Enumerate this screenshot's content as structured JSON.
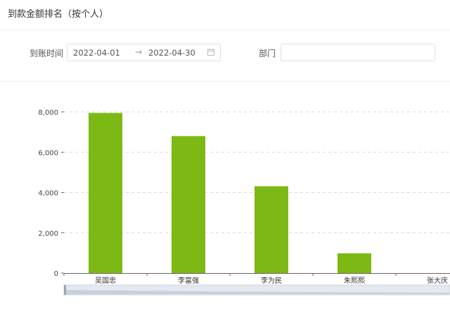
{
  "header": {
    "title": "到款金额排名（按个人）"
  },
  "filters": {
    "date_label": "到账时间",
    "start_date": "2022-04-01",
    "arrow": "→",
    "end_date": "2022-04-30",
    "dept_label": "部门",
    "dept_value": ""
  },
  "colors": {
    "bar": "#7db914",
    "grid": "#d9d9d9",
    "axis": "#666666"
  },
  "icons": {
    "calendar": "calendar-icon"
  },
  "chart_data": {
    "type": "bar",
    "categories": [
      "吴国忠",
      "李富强",
      "李为民",
      "朱熙熙",
      "张大庆"
    ],
    "values": [
      7950,
      6800,
      4310,
      980,
      0
    ],
    "y_ticks": [
      "0",
      "2,000",
      "4,000",
      "6,000",
      "8,000"
    ],
    "ylim": [
      0,
      8000
    ],
    "grid": true,
    "has_zoom_slider": true
  }
}
